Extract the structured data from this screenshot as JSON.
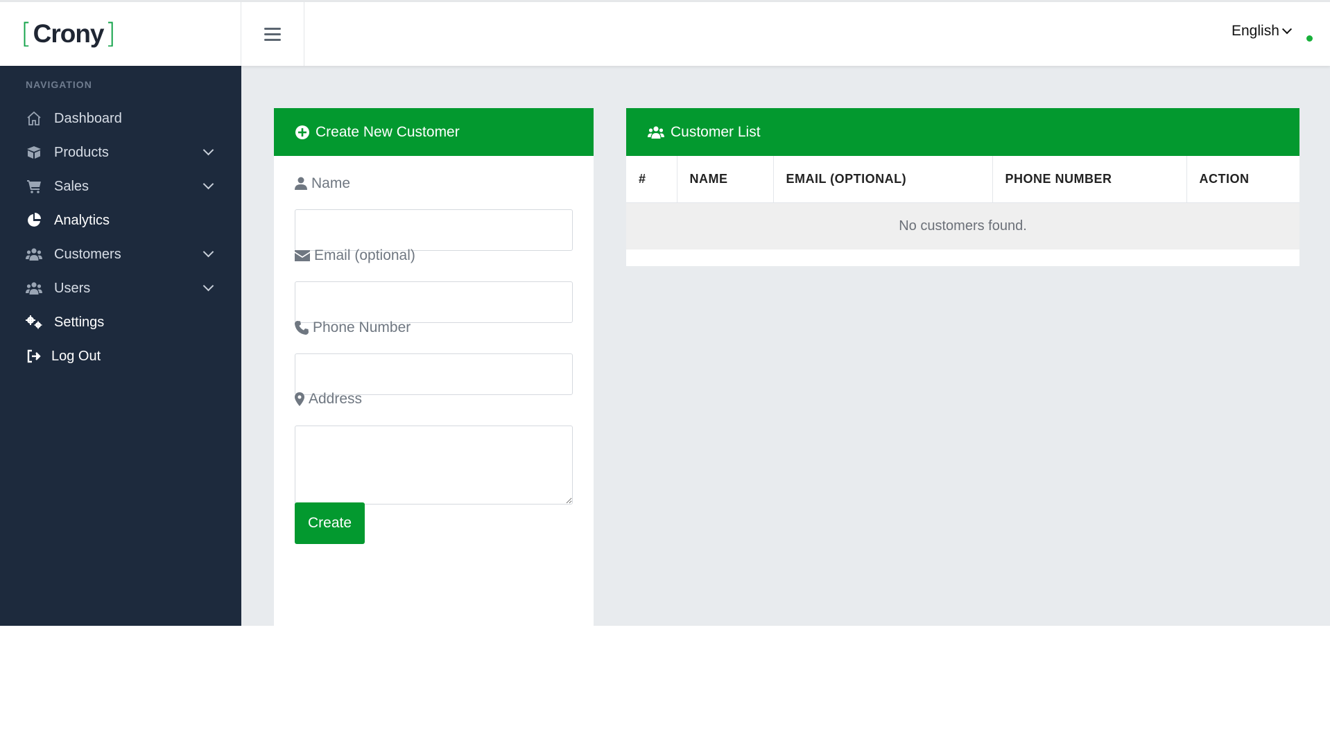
{
  "brand": {
    "name": "Crony",
    "open_bracket": "[",
    "close_bracket": "]"
  },
  "header": {
    "language": "English"
  },
  "sidebar": {
    "heading": "NAVIGATION",
    "items": [
      {
        "label": "Dashboard",
        "icon": "home-icon",
        "has_submenu": false
      },
      {
        "label": "Products",
        "icon": "box-icon",
        "has_submenu": true
      },
      {
        "label": "Sales",
        "icon": "cart-icon",
        "has_submenu": true
      },
      {
        "label": "Analytics",
        "icon": "pie-chart-icon",
        "has_submenu": false
      },
      {
        "label": "Customers",
        "icon": "users-icon",
        "has_submenu": true
      },
      {
        "label": "Users",
        "icon": "users-icon",
        "has_submenu": true
      },
      {
        "label": "Settings",
        "icon": "gears-icon",
        "has_submenu": false
      },
      {
        "label": "Log Out",
        "icon": "logout-icon",
        "has_submenu": false
      }
    ]
  },
  "create_form": {
    "title": "Create New Customer",
    "fields": {
      "name": {
        "label": "Name",
        "value": ""
      },
      "email": {
        "label": "Email (optional)",
        "value": ""
      },
      "phone": {
        "label": "Phone Number",
        "value": ""
      },
      "address": {
        "label": "Address",
        "value": ""
      }
    },
    "submit_label": "Create"
  },
  "customer_list": {
    "title": "Customer List",
    "columns": [
      "#",
      "NAME",
      "EMAIL (OPTIONAL)",
      "PHONE NUMBER",
      "ACTION"
    ],
    "rows": [],
    "empty_message": "No customers found."
  },
  "colors": {
    "primary_green": "#03992f",
    "sidebar_bg": "#1d2a3d",
    "content_bg": "#e8ebee",
    "status_dot": "#18b03a"
  }
}
